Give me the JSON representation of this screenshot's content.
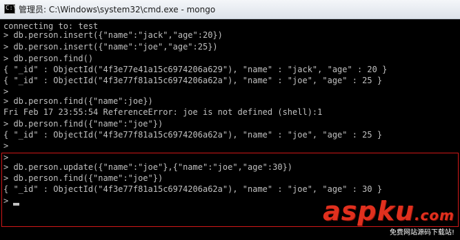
{
  "window": {
    "icon_text": "C:\\",
    "title": "管理员: C:\\Windows\\system32\\cmd.exe - mongo"
  },
  "console": {
    "lines": [
      "connecting to: test",
      "> db.person.insert({\"name\":\"jack\",\"age\":20})",
      "> db.person.insert({\"name\":\"joe\",\"age\":25})",
      "> db.person.find()",
      "{ \"_id\" : ObjectId(\"4f3e77e41a15c6974206a629\"), \"name\" : \"jack\", \"age\" : 20 }",
      "{ \"_id\" : ObjectId(\"4f3e77f81a15c6974206a62a\"), \"name\" : \"joe\", \"age\" : 25 }",
      ">",
      "> db.person.find({\"name\":joe})",
      "Fri Feb 17 23:55:54 ReferenceError: joe is not defined (shell):1",
      "> db.person.find({\"name\":\"joe\"})",
      "{ \"_id\" : ObjectId(\"4f3e77f81a15c6974206a62a\"), \"name\" : \"joe\", \"age\" : 25 }",
      ">",
      ">",
      "> db.person.update({\"name\":\"joe\"},{\"name\":\"joe\",\"age\":30})",
      "> db.person.find({\"name\":\"joe\"})",
      "{ \"_id\" : ObjectId(\"4f3e77f81a15c6974206a62a\"), \"name\" : \"joe\", \"age\" : 30 }",
      ">"
    ]
  },
  "watermark": {
    "main": "aspku",
    "tld": ".com",
    "sub": "免费网站源码下载站!"
  },
  "colors": {
    "console_text": "#c0c0c0",
    "console_bg": "#000000",
    "highlight_border": "#d21818",
    "watermark": "#e0301e"
  }
}
